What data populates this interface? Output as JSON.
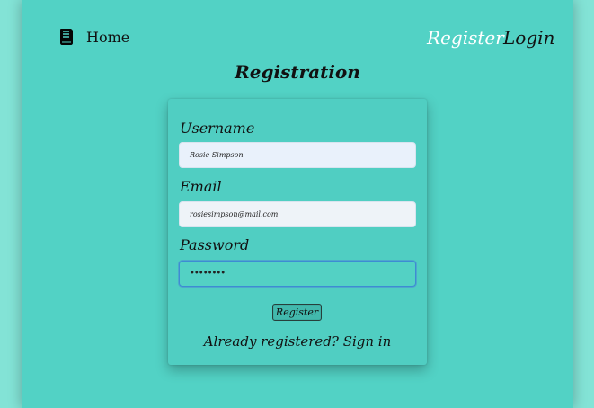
{
  "nav": {
    "brand_icon": "book-icon",
    "home": "Home",
    "register": "Register",
    "login": "Login"
  },
  "page": {
    "title": "Registration"
  },
  "form": {
    "username_label": "Username",
    "username_value": "Rosie Simpson",
    "email_label": "Email",
    "email_value": "rosiesimpson@mail.com",
    "password_label": "Password",
    "password_value": "••••••••",
    "submit_label": "Register",
    "signin_text": "Already registered? Sign in"
  },
  "colors": {
    "background": "#83e3d6",
    "page": "#52d2c5",
    "active_nav": "#ffffff",
    "focus_border": "#3d8cd3"
  }
}
